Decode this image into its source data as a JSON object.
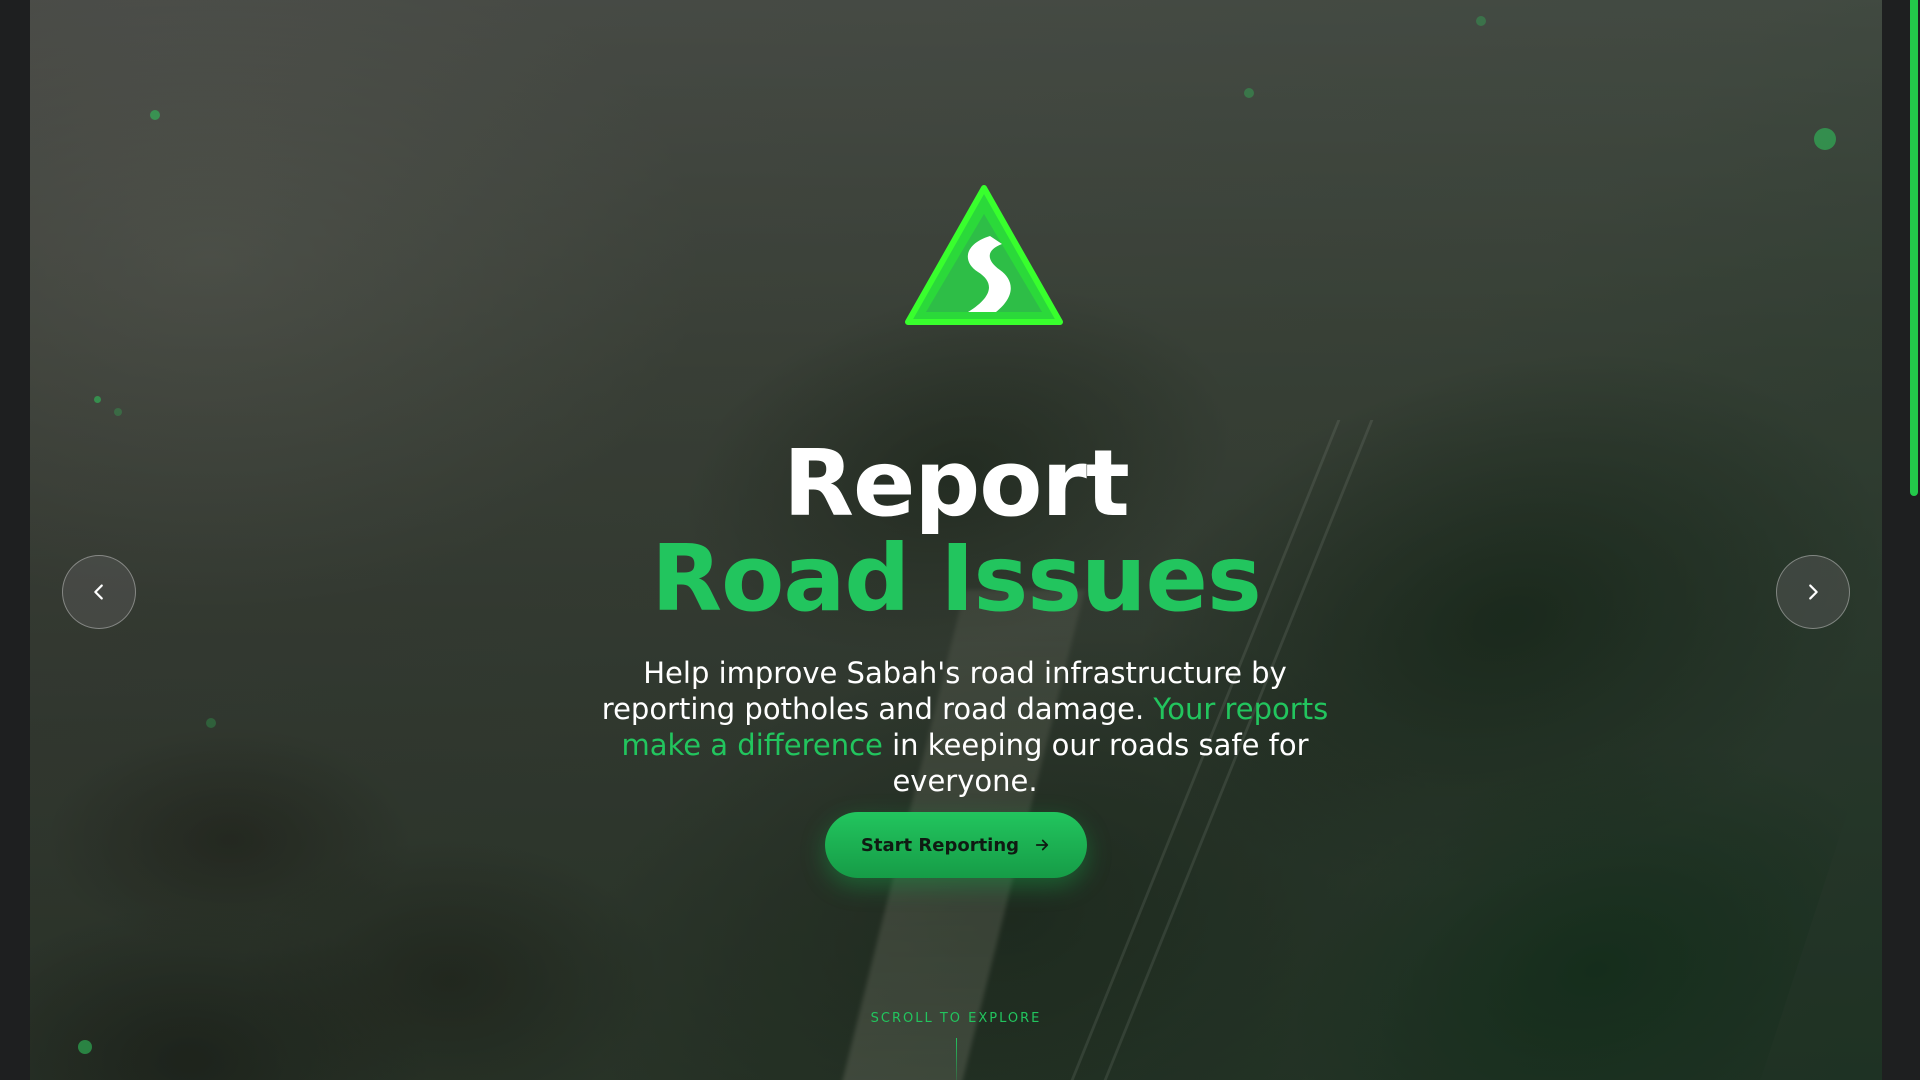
{
  "hero": {
    "title_line1": "Report",
    "title_line2": "Road Issues",
    "subtitle_part1": "Help improve Sabah's road infrastructure by reporting potholes and road damage. ",
    "subtitle_accent": "Your reports make a difference",
    "subtitle_part2": " in keeping our roads safe for everyone.",
    "cta_label": "Start Reporting",
    "scroll_hint": "SCROLL TO EXPLORE"
  },
  "icons": {
    "logo": "road-triangle-logo-icon",
    "prev": "chevron-left-icon",
    "next": "chevron-right-icon",
    "cta_arrow": "arrow-right-icon"
  },
  "colors": {
    "accent": "#22c55e",
    "title": "#ffffff",
    "background": "#1e1f20"
  }
}
